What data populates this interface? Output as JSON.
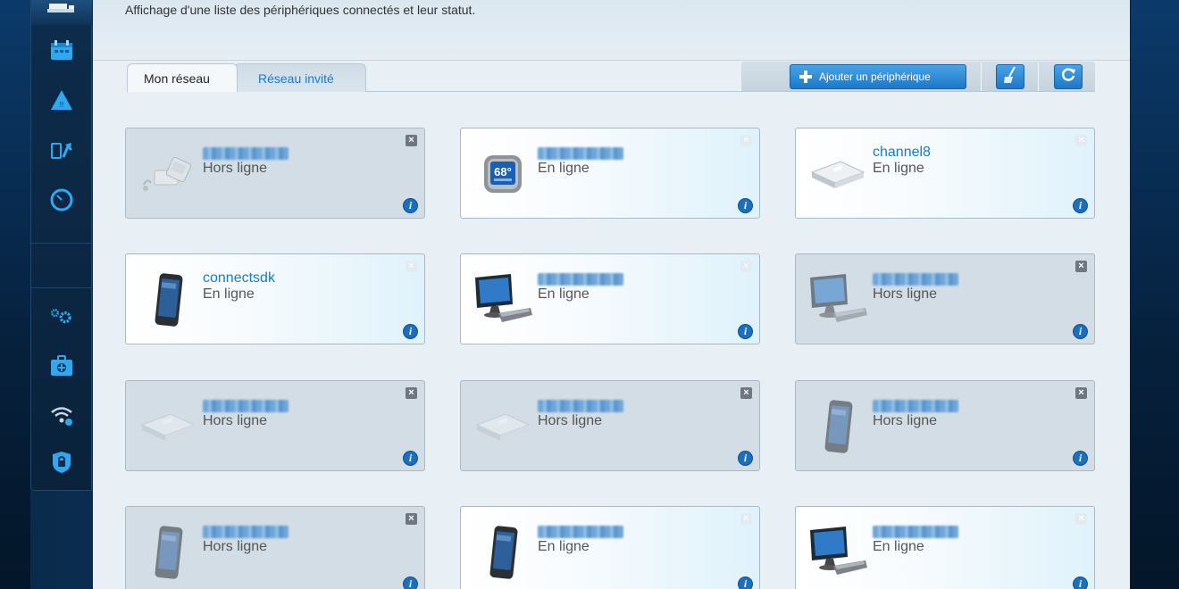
{
  "header": {
    "subtitle": "Affichage d'une liste des périphériques connectés et leur statut."
  },
  "tabs": [
    {
      "label": "Mon réseau",
      "active": true
    },
    {
      "label": "Réseau invité",
      "active": false
    }
  ],
  "toolbar": {
    "add_label": "Ajouter un périphérique",
    "buttons": [
      "broom-icon",
      "refresh-icon"
    ]
  },
  "sidebar": {
    "items": [
      {
        "icon": "router-icon"
      },
      {
        "icon": "calendar-icon"
      },
      {
        "icon": "warning-icon"
      },
      {
        "icon": "update-icon"
      },
      {
        "icon": "speedometer-icon"
      },
      {
        "icon": "settings-gears-icon"
      },
      {
        "icon": "troubleshoot-icon"
      },
      {
        "icon": "wifi-icon"
      },
      {
        "icon": "security-icon"
      }
    ]
  },
  "colors": {
    "accent": "#1a7bc4",
    "offline_card": "#d3dde5",
    "sidebar": "#0d2c4b"
  },
  "devices": [
    {
      "name": "",
      "blurred": true,
      "status": "Hors ligne",
      "online": false,
      "icon": "media-player-icon"
    },
    {
      "name": "",
      "blurred": true,
      "status": "En ligne",
      "online": true,
      "icon": "thermostat-icon"
    },
    {
      "name": "channel8",
      "blurred": false,
      "status": "En ligne",
      "online": true,
      "icon": "network-drive-icon"
    },
    {
      "name": "connectsdk",
      "blurred": false,
      "status": "En ligne",
      "online": true,
      "icon": "smartphone-icon"
    },
    {
      "name": "",
      "blurred": true,
      "status": "En ligne",
      "online": true,
      "icon": "desktop-computer-icon"
    },
    {
      "name": "",
      "blurred": true,
      "status": "Hors ligne",
      "online": false,
      "icon": "desktop-computer-icon"
    },
    {
      "name": "",
      "blurred": true,
      "status": "Hors ligne",
      "online": false,
      "icon": "network-drive-icon"
    },
    {
      "name": "",
      "blurred": true,
      "status": "Hors ligne",
      "online": false,
      "icon": "network-drive-icon"
    },
    {
      "name": "",
      "blurred": true,
      "status": "Hors ligne",
      "online": false,
      "icon": "smartphone-icon"
    },
    {
      "name": "",
      "blurred": true,
      "status": "Hors ligne",
      "online": false,
      "icon": "smartphone-icon"
    },
    {
      "name": "",
      "blurred": true,
      "status": "En ligne",
      "online": true,
      "icon": "smartphone-icon"
    },
    {
      "name": "",
      "blurred": true,
      "status": "En ligne",
      "online": true,
      "icon": "desktop-computer-icon"
    }
  ]
}
